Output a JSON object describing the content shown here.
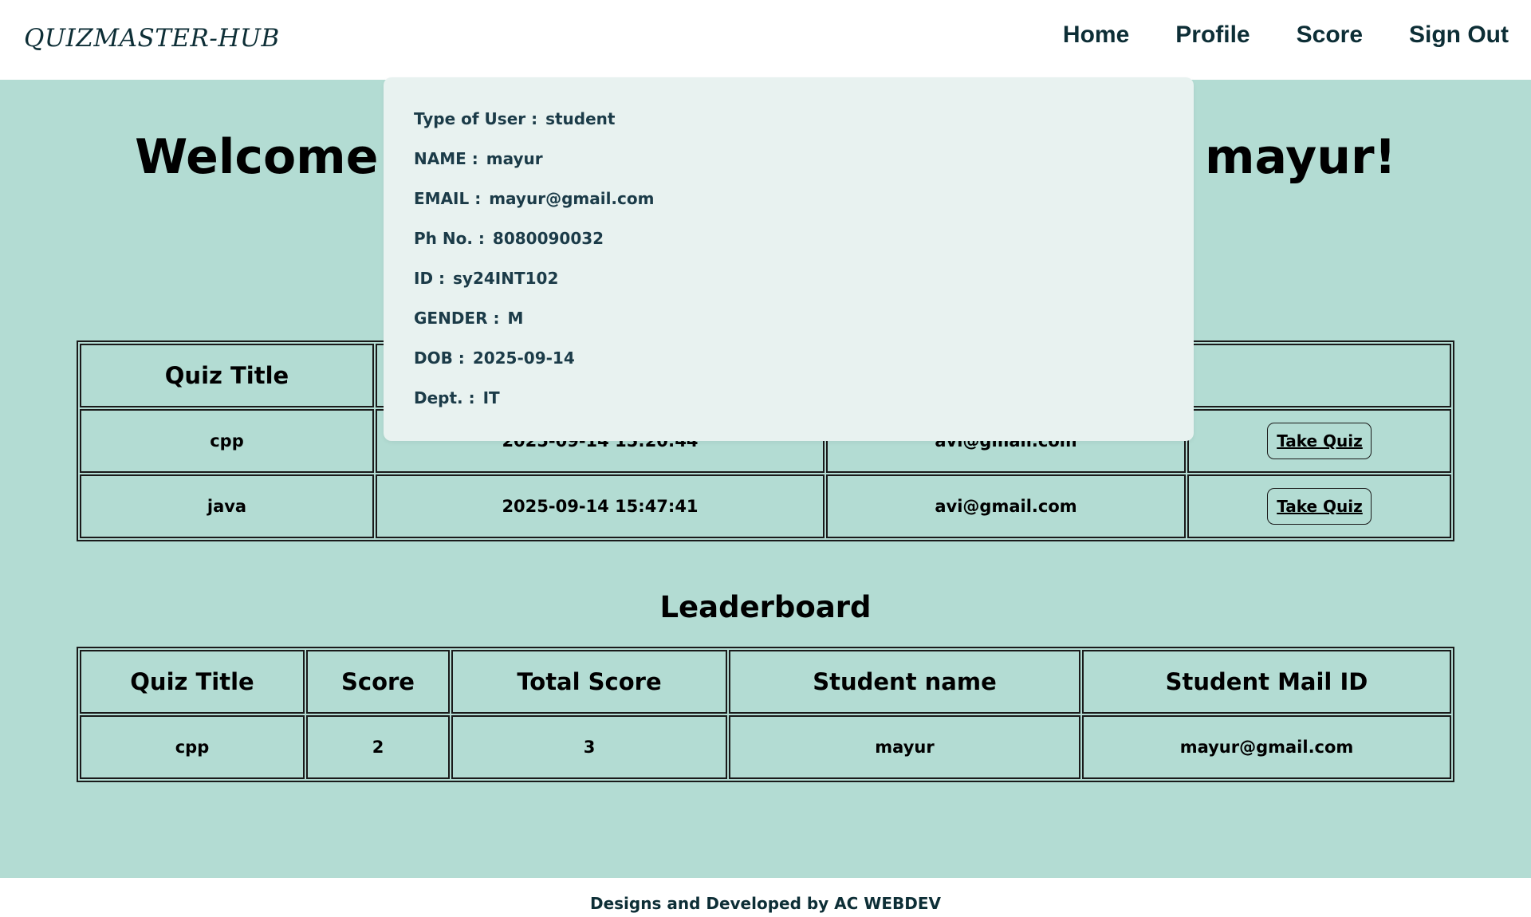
{
  "header": {
    "brand": "QUIZMASTER-HUB",
    "nav": [
      "Home",
      "Profile",
      "Score",
      "Sign Out"
    ]
  },
  "welcome": {
    "text": "Welcome to QuizMaster-Hub Quiz Zone  mayur!"
  },
  "quiz_table": {
    "headers": [
      "Quiz Title",
      "",
      "",
      ""
    ],
    "rows": [
      {
        "title": "cpp",
        "date": "2025-09-14 15:20:44",
        "mail": "avi@gmail.com",
        "action": "Take Quiz"
      },
      {
        "title": "java",
        "date": "2025-09-14 15:47:41",
        "mail": "avi@gmail.com",
        "action": "Take Quiz"
      }
    ]
  },
  "leaderboard": {
    "title": "Leaderboard",
    "headers": [
      "Quiz Title",
      "Score",
      "Total Score",
      "Student name",
      "Student Mail ID"
    ],
    "rows": [
      {
        "quiz": "cpp",
        "score": "2",
        "total": "3",
        "name": "mayur",
        "mail": "mayur@gmail.com"
      }
    ]
  },
  "profile": {
    "items": [
      {
        "label": "Type of User :",
        "value": "student"
      },
      {
        "label": "NAME :",
        "value": "mayur"
      },
      {
        "label": "EMAIL :",
        "value": "mayur@gmail.com"
      },
      {
        "label": "Ph No. :",
        "value": "8080090032"
      },
      {
        "label": "ID :",
        "value": "sy24INT102"
      },
      {
        "label": "GENDER :",
        "value": "M"
      },
      {
        "label": "DOB :",
        "value": "2025-09-14"
      },
      {
        "label": "Dept. :",
        "value": "IT"
      }
    ]
  },
  "footer": {
    "text": "Designs and Developed by AC WEBDEV"
  },
  "colors": {
    "main_bg": "#b3dcd3",
    "popup_bg": "#e8f2f0",
    "nav_text": "#0d2e36"
  }
}
